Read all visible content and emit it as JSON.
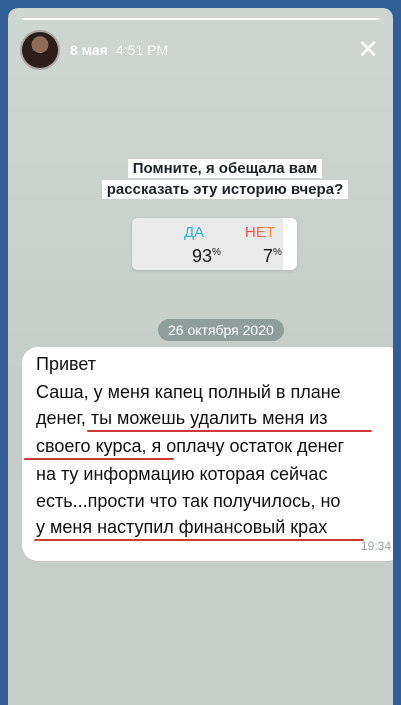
{
  "story": {
    "date": "8 мая",
    "time": "4:51 PM"
  },
  "question": {
    "line1": "Помните, я обещала вам",
    "line2": "рассказать эту историю вчера?"
  },
  "poll": {
    "yes_label": "ДА",
    "no_label": "НЕТ",
    "yes_percent": "93",
    "no_percent": "7",
    "percent_sign": "%",
    "yes_fraction": 0.93,
    "no_fraction": 0.07
  },
  "chat": {
    "date_pill": "26 октября 2020",
    "message_lines": [
      "Привет",
      "Саша, у меня капец полный в плане",
      "денег, ты можешь удалить меня из",
      "своего курса, я оплачу остаток денег",
      "на ту информацию которая сейчас",
      "есть...прости что так получилось, но",
      "у меня наступил финансовый крах"
    ],
    "message_time": "19:34"
  },
  "icons": {
    "close": "close-icon",
    "avatar": "avatar"
  },
  "colors": {
    "background": "#2f5f96",
    "underline": "#cc3a35",
    "poll_yes": "#2bb6cf",
    "poll_no_start": "#ff3b53",
    "poll_no_end": "#ff8e2c"
  }
}
